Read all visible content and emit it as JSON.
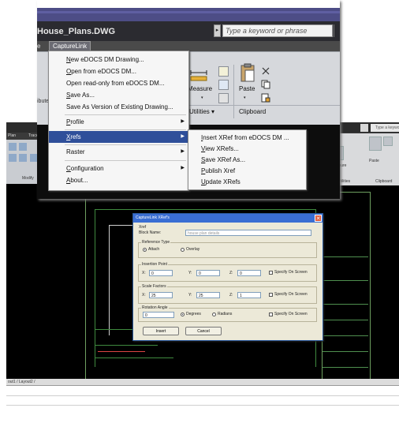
{
  "background_app": {
    "search_placeholder": "Type a keyword or phrase",
    "tabs": [
      "Plan",
      "Trace"
    ],
    "panel_labels": [
      "Measure",
      "Paste",
      "Utilities",
      "Clipboard",
      "Modify"
    ],
    "statusbar_text": "out1 / Layout2 /"
  },
  "dialog": {
    "title": "CaptureLink XRef's",
    "close_glyph": "✕",
    "file_label": "Xref",
    "block_name_label": "Block Name:",
    "block_name_value": "house plan details",
    "reference_type": {
      "group_label": "Reference Type",
      "attach": "Attach",
      "overlay": "Overlay",
      "selected": "Attach"
    },
    "insertion_point": {
      "group_label": "Insertion Point",
      "x_label": "X:",
      "x_value": "0",
      "y_label": "Y:",
      "y_value": "0",
      "z_label": "Z:",
      "z_value": "0",
      "specify_label": "Specify On Screen"
    },
    "scale_factors": {
      "group_label": "Scale Factors",
      "x_label": "X:",
      "x_value": "25",
      "y_label": "Y:",
      "y_value": "25",
      "z_label": "Z:",
      "z_value": "1",
      "specify_label": "Specify On Screen"
    },
    "rotation": {
      "group_label": "Rotation Angle",
      "value": "0",
      "degrees": "Degrees",
      "radians": "Radians",
      "selected": "Degrees",
      "specify_label": "Specify On Screen"
    },
    "insert_button": "Insert",
    "cancel_button": "Cancel"
  },
  "foreground_app": {
    "title": "House_Plans.DWG",
    "search_placeholder": "Type a keyword or phrase",
    "search_arrow": "▸",
    "tab_partial": "e",
    "tab_capturelink": "CaptureLink",
    "left_partial_label": "ibute",
    "measure_label": "Measure",
    "paste_label": "Paste",
    "utilities_label": "Utilities ▾",
    "clipboard_label": "Clipboard",
    "dropdown_arrow": "▾"
  },
  "menu": {
    "items": [
      {
        "prefix": "N",
        "label": "ew eDOCS DM Drawing..."
      },
      {
        "prefix": "O",
        "label": "pen from eDOCS DM..."
      },
      {
        "prefix": "",
        "label": "Open read-only from eDOCS DM..."
      },
      {
        "prefix": "S",
        "label": "ave As..."
      },
      {
        "prefix": "",
        "label": "Save As Version of Existing Drawing..."
      },
      {
        "prefix": "P",
        "label": "rofile",
        "arrow": "▶"
      },
      {
        "prefix": "X",
        "label": "refs",
        "arrow": "▶"
      },
      {
        "prefix": "",
        "label": "Raster",
        "arrow": "▶"
      },
      {
        "prefix": "C",
        "label": "onfiguration",
        "arrow": "▶"
      },
      {
        "prefix": "A",
        "label": "bout..."
      }
    ],
    "highlighted": "Xrefs"
  },
  "submenu": {
    "items": [
      {
        "prefix": "I",
        "label": "nsert XRef from eDOCS DM ..."
      },
      {
        "prefix": "V",
        "label": "iew XRefs..."
      },
      {
        "prefix": "S",
        "label": "ave XRef As..."
      },
      {
        "prefix": "P",
        "label": "ublish Xref"
      },
      {
        "prefix": "U",
        "label": "pdate XRefs"
      }
    ]
  }
}
